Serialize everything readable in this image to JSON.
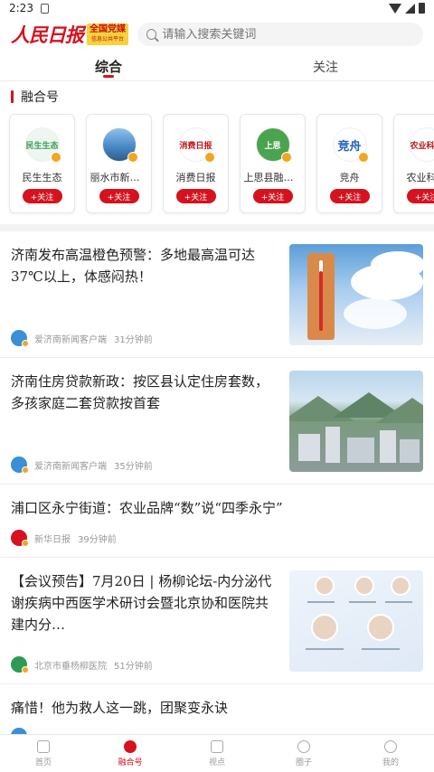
{
  "status_bar": {
    "time": "2:23"
  },
  "header": {
    "logo_text": "人民日报",
    "logo_badge": "全国党媒",
    "logo_badge_sub": "信息公共平台",
    "search_placeholder": "请输入搜索关键词"
  },
  "tabs": [
    {
      "label": "综合",
      "active": true
    },
    {
      "label": "关注",
      "active": false
    }
  ],
  "section": {
    "title": "融合号"
  },
  "accounts": [
    {
      "name": "民生生态",
      "avatar_text": "民生生态",
      "avatar_color": "#3f9b5a",
      "follow_label": "+关注"
    },
    {
      "name": "丽水市新闻…",
      "avatar_text": "",
      "avatar_color": "#4a89c9",
      "follow_label": "+关注"
    },
    {
      "name": "消费日报",
      "avatar_text": "消费日报",
      "avatar_color": "#c4141b",
      "follow_label": "+关注"
    },
    {
      "name": "上思县融媒…",
      "avatar_text": "上思",
      "avatar_color": "#4aa34f",
      "follow_label": "+关注"
    },
    {
      "name": "竞舟",
      "avatar_text": "竞舟",
      "avatar_color": "#1f63b8",
      "follow_label": "+关注"
    },
    {
      "name": "农业科技",
      "avatar_text": "农业科技",
      "avatar_color": "#b8141a",
      "follow_label": "+关注"
    }
  ],
  "news": [
    {
      "title": "济南发布高温橙色预警：多地最高温可达37℃以上，体感闷热！",
      "source": "爱济南新闻客户端",
      "time": "31分钟前",
      "source_color": "#3a8fd6"
    },
    {
      "title": "济南住房贷款新政：按区县认定住房套数，多孩家庭二套贷款按首套",
      "source": "爱济南新闻客户端",
      "time": "35分钟前",
      "source_color": "#3a8fd6"
    },
    {
      "title": "浦口区永宁街道：农业品牌“数”说“四季永宁”",
      "source": "新华日报",
      "time": "39分钟前",
      "source_color": "#d6121e"
    },
    {
      "title": "【会议预告】7月20日 | 杨柳论坛-内分泌代谢疾病中西医学术研讨会暨北京协和医院共建内分…",
      "source": "北京市垂杨柳医院",
      "time": "51分钟前",
      "source_color": "#2e9a55"
    },
    {
      "title": "痛惜！他为救人这一跳，团聚变永诀",
      "source_color": "#3a8fd6"
    }
  ],
  "bottom_nav": [
    {
      "label": "首页",
      "icon": "home-icon",
      "active": false
    },
    {
      "label": "融合号",
      "icon": "rong-icon",
      "active": true
    },
    {
      "label": "视点",
      "icon": "video-icon",
      "active": false
    },
    {
      "label": "圈子",
      "icon": "circle-icon",
      "active": false
    },
    {
      "label": "我的",
      "icon": "user-icon",
      "active": false
    }
  ]
}
